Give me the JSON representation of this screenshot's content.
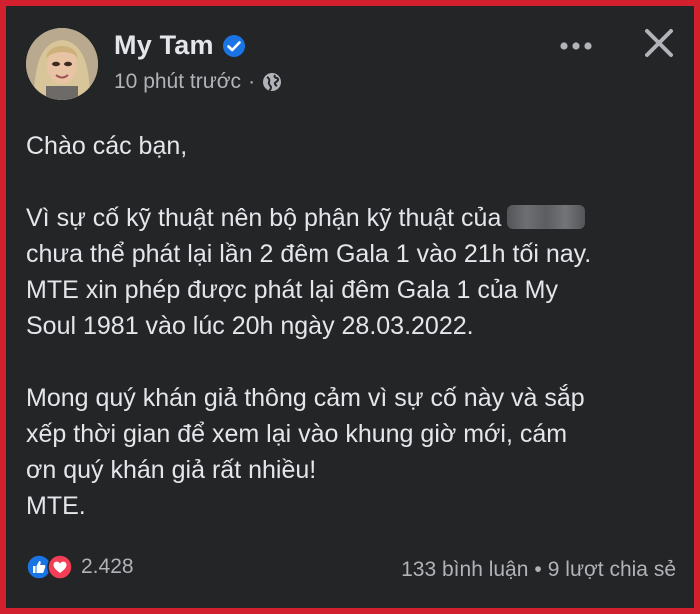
{
  "post": {
    "author_name": "My Tam",
    "timestamp": "10 phút trước",
    "meta_separator": "·",
    "paragraphs": [
      [
        "Chào các bạn,"
      ],
      [
        "Vì sự cố kỹ thuật nên bộ phận kỹ thuật của",
        "chưa thể phát lại lần 2 đêm Gala 1 vào 21h tối nay.",
        "MTE xin phép được phát lại đêm Gala 1 của My",
        "Soul 1981 vào lúc 20h ngày 28.03.2022."
      ],
      [
        "Mong quý khán giả thông cảm vì sự cố này và sắp",
        "xếp thời gian để xem lại vào khung giờ mới, cám",
        "ơn quý khán giả rất nhiều!",
        "MTE."
      ]
    ]
  },
  "footer": {
    "reaction_count": "2.428",
    "comments": "133 bình luận",
    "separator": "•",
    "shares": "9 lượt chia sẻ"
  },
  "icons": {
    "verified": "verified-badge-icon",
    "globe": "globe-icon",
    "more": "more-options-icon",
    "close": "close-icon",
    "like": "like-reaction-icon",
    "love": "love-reaction-icon"
  },
  "colors": {
    "background": "#242526",
    "frame_border": "#d3202f",
    "primary_text": "#e4e6eb",
    "secondary_text": "#b0b3b8",
    "facebook_blue": "#1b74e4",
    "love_red": "#f33e58"
  }
}
